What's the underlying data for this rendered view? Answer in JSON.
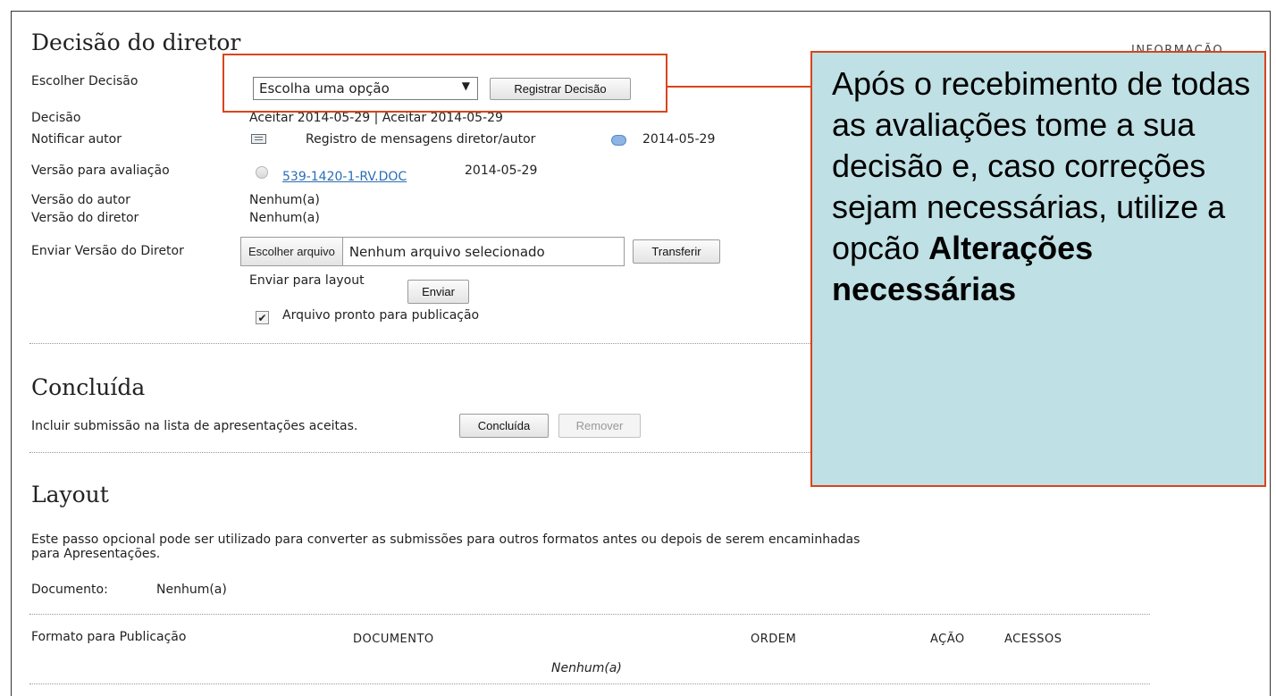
{
  "header": {
    "title": "Decisão do diretor",
    "info_link": "INFORMAÇÃO"
  },
  "decision": {
    "choose_label": "Escolher Decisão",
    "select_value": "Escolha uma opção",
    "register_button": "Registrar Decisão",
    "decision_label": "Decisão",
    "decision_value": "Aceitar  2014-05-29 | Aceitar  2014-05-29",
    "notify_label": "Notificar autor",
    "notify_text": "Registro de mensagens diretor/autor",
    "notify_date": "2014-05-29",
    "review_version_label": "Versão para avaliação",
    "review_file": "539-1420-1-RV.DOC",
    "review_date": "2014-05-29",
    "author_version_label": "Versão do autor",
    "author_version_value": "Nenhum(a)",
    "director_version_label": "Versão do diretor",
    "director_version_value": "Nenhum(a)",
    "send_version_label": "Enviar Versão do Diretor",
    "choose_file_button": "Escolher arquivo",
    "no_file_text": "Nenhum arquivo selecionado",
    "transfer_button": "Transferir",
    "send_layout_label": "Enviar para layout",
    "send_button": "Enviar",
    "ready_checkbox_label": "Arquivo pronto para publicação",
    "ready_checked": true
  },
  "concluded": {
    "title": "Concluída",
    "text": "Incluir submissão na lista de apresentações aceitas.",
    "concluded_button": "Concluída",
    "remove_button": "Remover"
  },
  "layout": {
    "title": "Layout",
    "description_line1": "Este passo opcional pode ser utilizado para converter as submissões para outros formatos antes ou depois de serem encaminhadas",
    "description_line2": "para Apresentações.",
    "document_label": "Documento:",
    "document_value": "Nenhum(a)",
    "table": {
      "headers": [
        "Formato para Publicação",
        "DOCUMENTO",
        "ORDEM",
        "AÇÃO",
        "ACESSOS"
      ],
      "empty_text": "Nenhum(a)"
    }
  },
  "callout": {
    "text": "Após o recebimento de todas as avaliações tome a sua decisão e, caso correções sejam necessárias, utilize a opcão",
    "bold": "Alterações necessárias"
  },
  "colors": {
    "callout_bg": "#bfe0e4",
    "callout_border": "#d9441c",
    "link": "#2a6db5"
  }
}
